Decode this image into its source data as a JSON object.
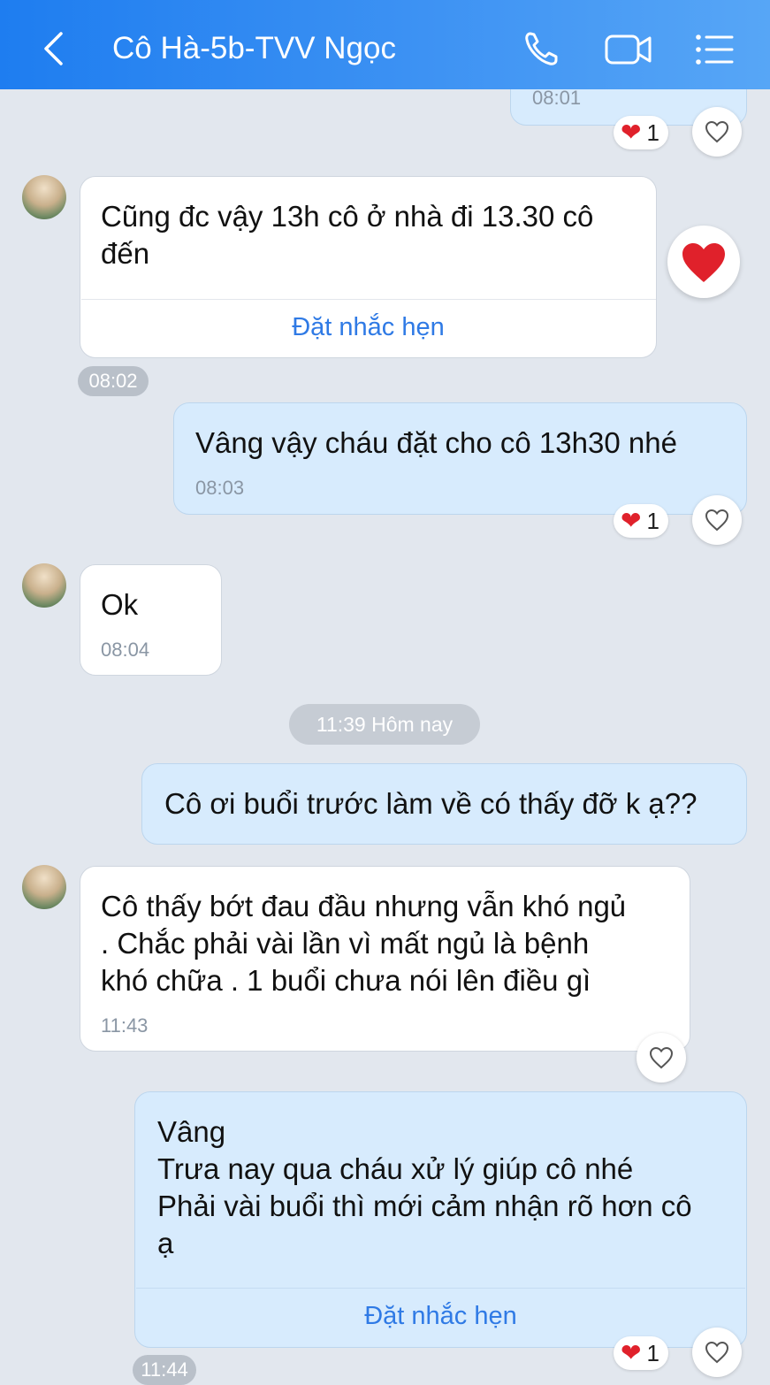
{
  "header": {
    "title": "Cô Hà-5b-TVV Ngọc"
  },
  "messages": {
    "m0": {
      "time": "08:01",
      "reaction_count": "1"
    },
    "m1": {
      "line1": "Cũng đc vậy 13h cô ở nhà đi 13.30 cô",
      "line2": "đến",
      "action": "Đặt nhắc hẹn",
      "time": "08:02"
    },
    "m2": {
      "text": "Vâng vậy cháu đặt cho cô 13h30 nhé",
      "time": "08:03",
      "reaction_count": "1"
    },
    "m3": {
      "text": "Ok",
      "time": "08:04"
    },
    "divider": "11:39 Hôm nay",
    "m4": {
      "text": "Cô ơi buổi trước làm về có thấy đỡ k ạ??"
    },
    "m5": {
      "line1": "Cô thấy bớt đau đầu nhưng vẫn khó ngủ",
      "line2": ". Chắc phải vài lần vì mất ngủ là bệnh",
      "line3": "khó chữa . 1 buổi chưa nói lên điều gì",
      "time": "11:43"
    },
    "m6": {
      "line1": "Vâng",
      "line2": "Trưa nay qua cháu xử lý giúp cô nhé",
      "line3": "Phải vài buổi thì mới cảm nhận rõ hơn cô",
      "line4": "ạ",
      "action": "Đặt nhắc hẹn",
      "time": "11:44",
      "reaction_count": "1"
    }
  },
  "colors": {
    "header_start": "#1e7df0",
    "header_end": "#57a6f6",
    "background": "#e2e7ee",
    "outgoing_bubble": "#d7ebfd",
    "incoming_bubble": "#ffffff",
    "link": "#2f7ae5",
    "heart": "#e0212b"
  },
  "icons": {
    "back": "chevron-left-icon",
    "call": "phone-icon",
    "video": "video-camera-icon",
    "menu": "list-menu-icon",
    "like": "heart-outline-icon",
    "reaction": "heart-filled-icon"
  }
}
